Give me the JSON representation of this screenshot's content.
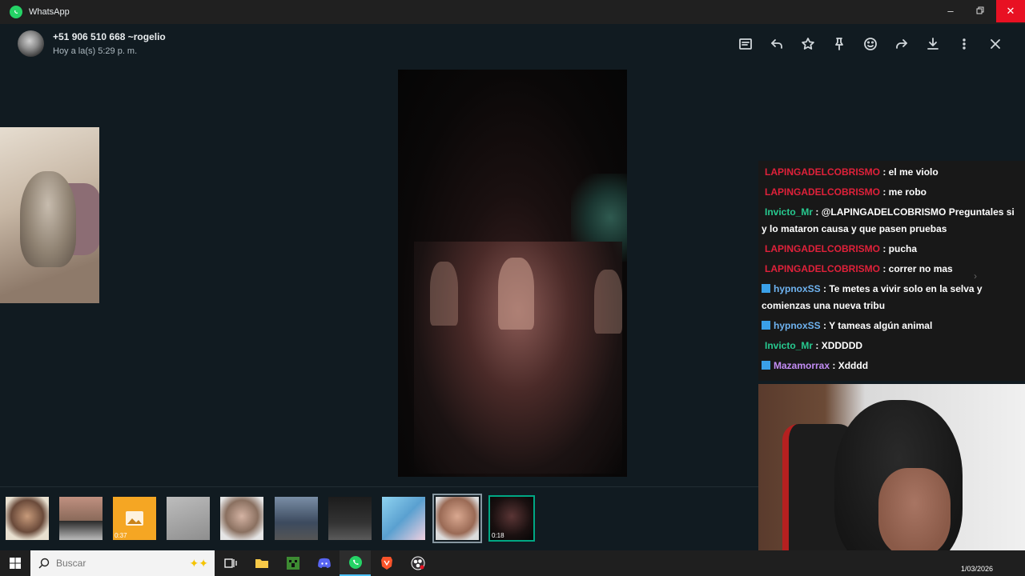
{
  "window": {
    "app_title": "WhatsApp"
  },
  "viewer": {
    "sender_name": "+51 906 510 668 ~rogelio",
    "sender_time": "Hoy a la(s) 5:29 p. m."
  },
  "thumbnails": [
    {
      "badge": ""
    },
    {
      "badge": ""
    },
    {
      "badge": "0:37"
    },
    {
      "badge": ""
    },
    {
      "badge": ""
    },
    {
      "badge": ""
    },
    {
      "badge": ""
    },
    {
      "badge": ""
    },
    {
      "badge": ""
    },
    {
      "badge": "0:18"
    }
  ],
  "chat": {
    "messages": [
      {
        "user": "LAPINGADELCOBRISMO",
        "text": ": el me violo"
      },
      {
        "user": "LAPINGADELCOBRISMO",
        "text": ": me robo"
      },
      {
        "user": "Invicto_Mr",
        "text": ": @LAPINGADELCOBRISMO Preguntales si y lo mataron causa y que pasen pruebas"
      },
      {
        "user": "LAPINGADELCOBRISMO",
        "text": ": pucha"
      },
      {
        "user": "LAPINGADELCOBRISMO",
        "text": ": correr no mas"
      },
      {
        "user": "hypnoxSS",
        "text": ": Te metes a vivir solo en la selva y comienzas una nueva tribu"
      },
      {
        "user": "hypnoxSS",
        "text": ": Y tameas algún animal"
      },
      {
        "user": "Invicto_Mr",
        "text": ": XDDDDD"
      },
      {
        "user": "Mazamorrax",
        "text": ": Xdddd"
      }
    ]
  },
  "taskbar": {
    "search_placeholder": "Buscar",
    "date": "1/03/2026"
  },
  "colors": {
    "accent": "#25d366",
    "close_red": "#e81123",
    "user_red": "#e0213a",
    "user_green": "#27c98f",
    "user_blue": "#6fb3f0",
    "user_purple": "#c38df5"
  }
}
